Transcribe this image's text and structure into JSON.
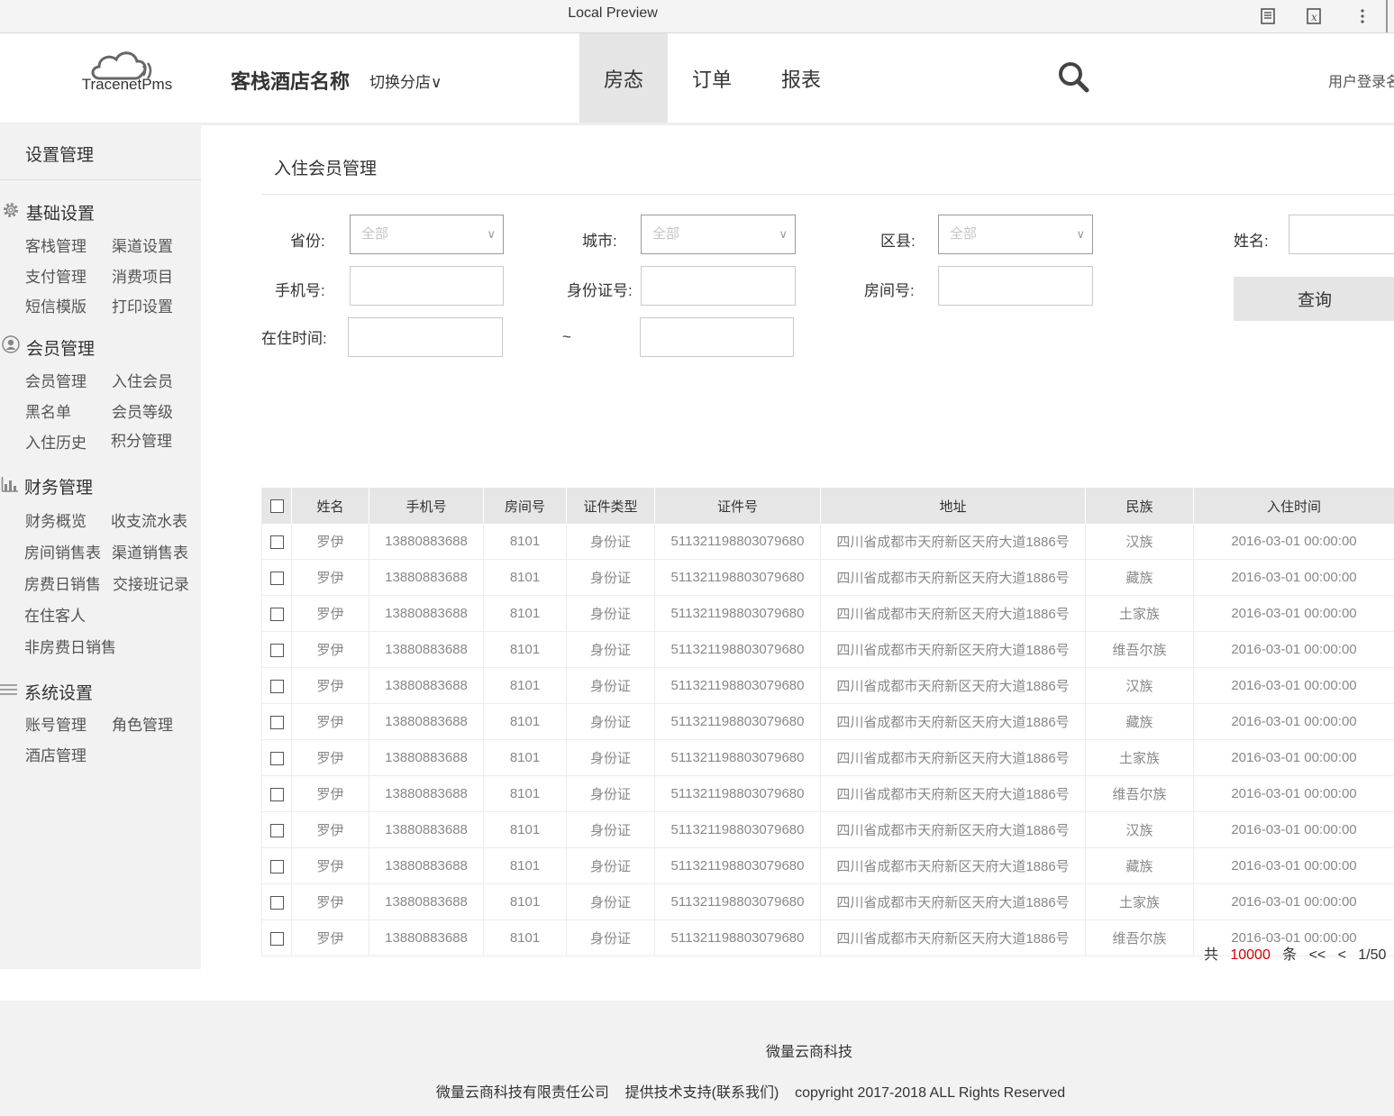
{
  "browser": {
    "title": "Local Preview"
  },
  "header": {
    "logo_text": "TracenetPms",
    "hotel_name": "客栈酒店名称",
    "switch_branch": "切换分店∨",
    "nav": [
      {
        "label": "房态",
        "active": true
      },
      {
        "label": "订单",
        "active": false
      },
      {
        "label": "报表",
        "active": false
      }
    ],
    "user_login": "用户登录名"
  },
  "sidebar": {
    "title": "设置管理",
    "groups": [
      {
        "title": "基础设置",
        "icon": "gear-icon",
        "items": [
          "客栈管理",
          "渠道设置",
          "支付管理",
          "消费项目",
          "短信模版",
          "打印设置"
        ]
      },
      {
        "title": "会员管理",
        "icon": "user-icon",
        "items": [
          "会员管理",
          "入住会员",
          "黑名单",
          "会员等级",
          "入住历史",
          "积分管理"
        ]
      },
      {
        "title": "财务管理",
        "icon": "bar-chart-icon",
        "items": [
          "财务概览",
          "收支流水表",
          "房间销售表",
          "渠道销售表",
          "房费日销售",
          "交接班记录",
          "在住客人",
          "非房费日销售"
        ]
      },
      {
        "title": "系统设置",
        "icon": "menu-icon",
        "items": [
          "账号管理",
          "角色管理",
          "酒店管理"
        ]
      }
    ]
  },
  "main": {
    "title": "入住会员管理",
    "filters": {
      "province_label": "省份:",
      "province_value": "全部",
      "city_label": "城市:",
      "city_value": "全部",
      "district_label": "区县:",
      "district_value": "全部",
      "name_label": "姓名:",
      "phone_label": "手机号:",
      "idcard_label": "身份证号:",
      "room_label": "房间号:",
      "stay_label": "在住时间:",
      "range_sep": "~",
      "query_button": "查询"
    }
  },
  "table": {
    "columns": [
      "姓名",
      "手机号",
      "房间号",
      "证件类型",
      "证件号",
      "地址",
      "民族",
      "入住时间"
    ],
    "rows": [
      [
        "罗伊",
        "13880883688",
        "8101",
        "身份证",
        "511321198803079680",
        "四川省成都市天府新区天府大道1886号",
        "汉族",
        "2016-03-01 00:00:00"
      ],
      [
        "罗伊",
        "13880883688",
        "8101",
        "身份证",
        "511321198803079680",
        "四川省成都市天府新区天府大道1886号",
        "藏族",
        "2016-03-01 00:00:00"
      ],
      [
        "罗伊",
        "13880883688",
        "8101",
        "身份证",
        "511321198803079680",
        "四川省成都市天府新区天府大道1886号",
        "土家族",
        "2016-03-01 00:00:00"
      ],
      [
        "罗伊",
        "13880883688",
        "8101",
        "身份证",
        "511321198803079680",
        "四川省成都市天府新区天府大道1886号",
        "维吾尔族",
        "2016-03-01 00:00:00"
      ],
      [
        "罗伊",
        "13880883688",
        "8101",
        "身份证",
        "511321198803079680",
        "四川省成都市天府新区天府大道1886号",
        "汉族",
        "2016-03-01 00:00:00"
      ],
      [
        "罗伊",
        "13880883688",
        "8101",
        "身份证",
        "511321198803079680",
        "四川省成都市天府新区天府大道1886号",
        "藏族",
        "2016-03-01 00:00:00"
      ],
      [
        "罗伊",
        "13880883688",
        "8101",
        "身份证",
        "511321198803079680",
        "四川省成都市天府新区天府大道1886号",
        "土家族",
        "2016-03-01 00:00:00"
      ],
      [
        "罗伊",
        "13880883688",
        "8101",
        "身份证",
        "511321198803079680",
        "四川省成都市天府新区天府大道1886号",
        "维吾尔族",
        "2016-03-01 00:00:00"
      ],
      [
        "罗伊",
        "13880883688",
        "8101",
        "身份证",
        "511321198803079680",
        "四川省成都市天府新区天府大道1886号",
        "汉族",
        "2016-03-01 00:00:00"
      ],
      [
        "罗伊",
        "13880883688",
        "8101",
        "身份证",
        "511321198803079680",
        "四川省成都市天府新区天府大道1886号",
        "藏族",
        "2016-03-01 00:00:00"
      ],
      [
        "罗伊",
        "13880883688",
        "8101",
        "身份证",
        "511321198803079680",
        "四川省成都市天府新区天府大道1886号",
        "土家族",
        "2016-03-01 00:00:00"
      ],
      [
        "罗伊",
        "13880883688",
        "8101",
        "身份证",
        "511321198803079680",
        "四川省成都市天府新区天府大道1886号",
        "维吾尔族",
        "2016-03-01 00:00:00"
      ]
    ]
  },
  "pagination": {
    "prefix": "共",
    "total": "10000",
    "suffix": "条",
    "first": "<<",
    "prev": "<",
    "page": "1/50"
  },
  "footer": {
    "company": "微量云商科技",
    "line": "微量云商科技有限责任公司    提供技术支持(联系我们)    copyright 2017-2018 ALL Rights Reserved"
  },
  "colors": {
    "accent_red": "#d40000",
    "active_tab_bg": "#e5e5e5",
    "sidebar_bg": "#f2f2f2"
  }
}
